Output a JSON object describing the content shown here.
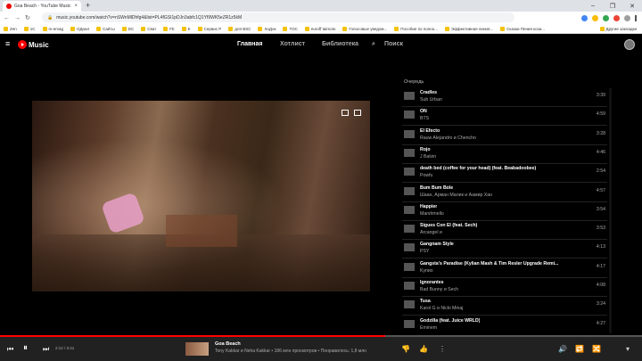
{
  "browser": {
    "tab_title": "Goa Beach - YouTube Music",
    "tab_close": "×",
    "new_tab": "+",
    "url": "music.youtube.com/watch?v=nSWnMlDhfg4&list=PL4fGSI1pDJn3abfc1Q1Yf9WK5eZR1z5kM",
    "window_controls": [
      "–",
      "❐",
      "✕"
    ],
    "bookmarks": [
      "Zen",
      "1C",
      "m-emag",
      "ОДнал",
      "Сайты",
      "DC",
      "Сват",
      "Fb",
      "K",
      "Сервис Р",
      "для BSC",
      "ХоДок",
      "TOC",
      "euroff taimoto",
      "Голосовые уведом...",
      "Пособие по полно...",
      "Эффективная линия...",
      "Сказки Пения коза..."
    ],
    "bookmarks_right": "Другие закладки"
  },
  "header": {
    "hamburger": "≡",
    "logo_text": "Music",
    "nav": [
      "Главная",
      "Хотлист",
      "Библиотека",
      "Поиск"
    ],
    "search_icon": "⌕"
  },
  "queue": {
    "label": "Очередь",
    "items": [
      {
        "title": "Cradles",
        "artist": "Sub Urban",
        "duration": "3:39"
      },
      {
        "title": "ON",
        "artist": "BTS",
        "duration": "4:59"
      },
      {
        "title": "El Efecto",
        "artist": "Rauw Alejandro и Chencho",
        "duration": "3:28"
      },
      {
        "title": "Rojo",
        "artist": "J Balvin",
        "duration": "4:46"
      },
      {
        "title": "death bed (coffee for your head) (feat. Beabadoobee)",
        "artist": "Powfu",
        "duration": "2:54"
      },
      {
        "title": "Bum Bum Bole",
        "artist": "Шаан, Арман Малик и Аамир Хан",
        "duration": "4:57"
      },
      {
        "title": "Happier",
        "artist": "Marshmello",
        "duration": "3:54"
      },
      {
        "title": "Sigues Con El (feat. Sech)",
        "artist": "Arcangel и",
        "duration": "3:53"
      },
      {
        "title": "Gangnam Style",
        "artist": "PSY",
        "duration": "4:13"
      },
      {
        "title": "Gangsta's Paradise (Kylian Mash & Tim Resler Upgrade Remi...",
        "artist": "Kyпио",
        "duration": "4:17"
      },
      {
        "title": "Ignorantes",
        "artist": "Bad Bunny и Sech",
        "duration": "4:08"
      },
      {
        "title": "Tusa",
        "artist": "Karol G и Nicki Minaj",
        "duration": "3:24"
      },
      {
        "title": "Godzilla (feat. Juice WRLD)",
        "artist": "Eminem",
        "duration": "4:27"
      }
    ]
  },
  "player": {
    "prev": "⏮",
    "play": "⏸",
    "next": "⏭",
    "time": "2:12 / 3:41",
    "progress": 0.6,
    "title": "Goa Beach",
    "subtitle": "Tony Kakkar и Neha Kakkar • 186 млн просмотров • Понравилось: 1,8 млн",
    "dislike": "👎",
    "like": "👍",
    "more": "⋮",
    "volume": "🔊",
    "repeat": "🔁",
    "shuffle": "🔀",
    "expand": "▾"
  }
}
